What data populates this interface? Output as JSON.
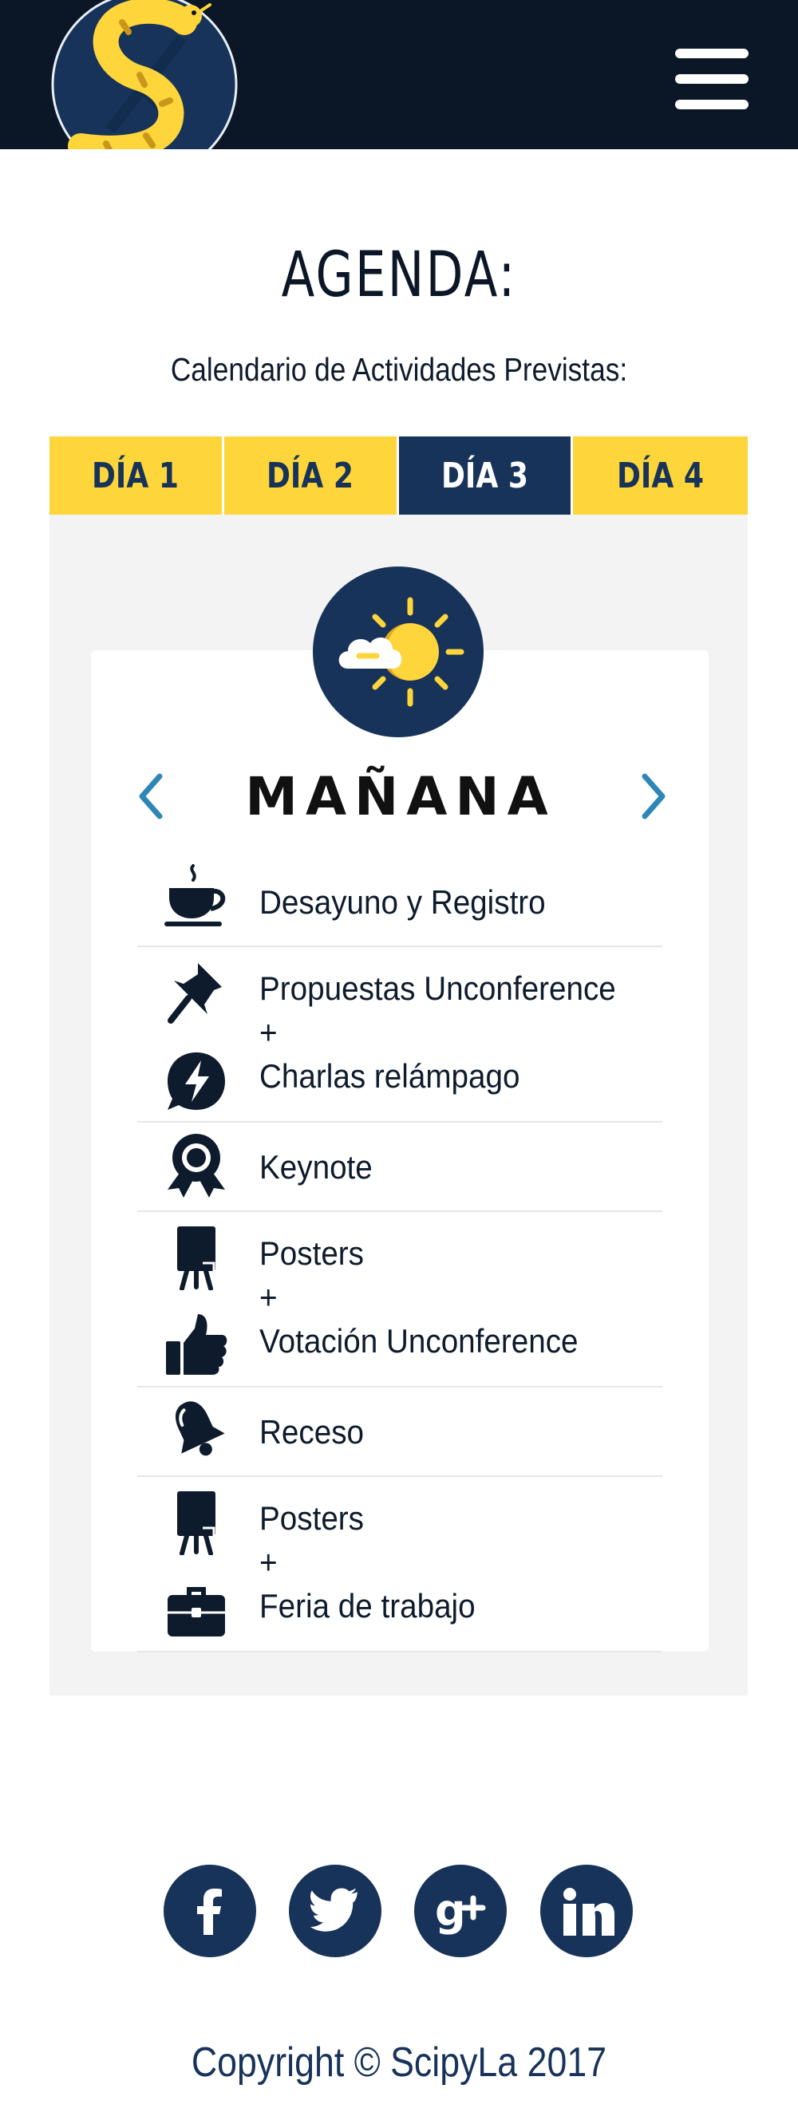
{
  "header": {
    "logo_icon": "snake-s-logo",
    "menu_icon": "hamburger-menu-icon"
  },
  "agenda": {
    "title": "AGENDA:",
    "subtitle": "Calendario de Actividades Previstas:",
    "tabs": [
      {
        "label": "DÍA 1",
        "active": false
      },
      {
        "label": "DÍA 2",
        "active": false
      },
      {
        "label": "DÍA 3",
        "active": true
      },
      {
        "label": "DÍA 4",
        "active": false
      }
    ],
    "period": "MAÑANA",
    "period_icon": "sun-cloud-icon",
    "activities": [
      {
        "lines": [
          "Desayuno y Registro"
        ],
        "icons": [
          "coffee-cup-icon"
        ]
      },
      {
        "lines": [
          "Propuestas Unconference",
          "+",
          "Charlas relámpago"
        ],
        "icons": [
          "pushpin-icon",
          "lightning-bubble-icon"
        ]
      },
      {
        "lines": [
          "Keynote"
        ],
        "icons": [
          "award-ribbon-icon"
        ]
      },
      {
        "lines": [
          "Posters",
          "+",
          "Votación Unconference"
        ],
        "icons": [
          "easel-poster-icon",
          "thumbs-up-icon"
        ]
      },
      {
        "lines": [
          "Receso"
        ],
        "icons": [
          "bell-icon"
        ]
      },
      {
        "lines": [
          "Posters",
          "+",
          "Feria de trabajo"
        ],
        "icons": [
          "easel-poster-icon",
          "briefcase-icon"
        ]
      }
    ]
  },
  "colors": {
    "navy": "#17335a",
    "header_bg": "#0b1726",
    "yellow": "#fed53a",
    "arrow_blue": "#2e86b7"
  },
  "footer": {
    "social": [
      "facebook-icon",
      "twitter-icon",
      "google-plus-icon",
      "linkedin-icon"
    ],
    "copyright": "Copyright © ScipyLa 2017"
  }
}
